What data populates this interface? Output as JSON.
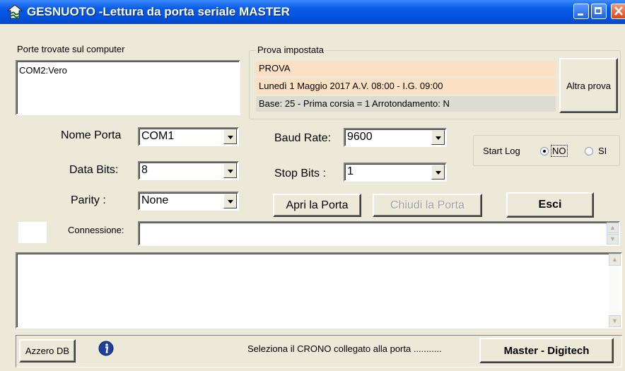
{
  "window": {
    "title": "GESNUOTO -Lettura da porta seriale MASTER"
  },
  "ports_group": {
    "label": "Porte trovate sul computer",
    "items": [
      "COM2:Vero"
    ]
  },
  "prova_group": {
    "label": "Prova impostata",
    "name": "PROVA",
    "date_line": "Lunedì 1 Maggio 2017 A.V. 08:00 - I.G. 09:00",
    "base_line": "Base: 25  -  Prima corsia = 1     Arrotondamento: N",
    "altra_prova_label": "Altra prova",
    "band_color": "#fce0c4"
  },
  "settings": {
    "nome_porta_label": "Nome Porta",
    "nome_porta_value": "COM1",
    "data_bits_label": "Data Bits:",
    "data_bits_value": "8",
    "parity_label": "Parity :",
    "parity_value": "None",
    "baud_rate_label": "Baud Rate:",
    "baud_rate_value": "9600",
    "stop_bits_label": "Stop Bits :",
    "stop_bits_value": "1"
  },
  "start_log": {
    "label": "Start Log",
    "no_label": "NO",
    "si_label": "SI",
    "selected": "NO"
  },
  "buttons": {
    "apri": "Apri la Porta",
    "chiudi": "Chiudi la Porta",
    "esci": "Esci",
    "azzero": "Azzero DB",
    "master": "Master - Digitech"
  },
  "connection": {
    "label": "Connessione:",
    "value": ""
  },
  "status": {
    "message": "Seleziona il CRONO collegato alla porta ..........."
  },
  "icons": {
    "title": "app-logo-icon",
    "info": "info-icon"
  }
}
